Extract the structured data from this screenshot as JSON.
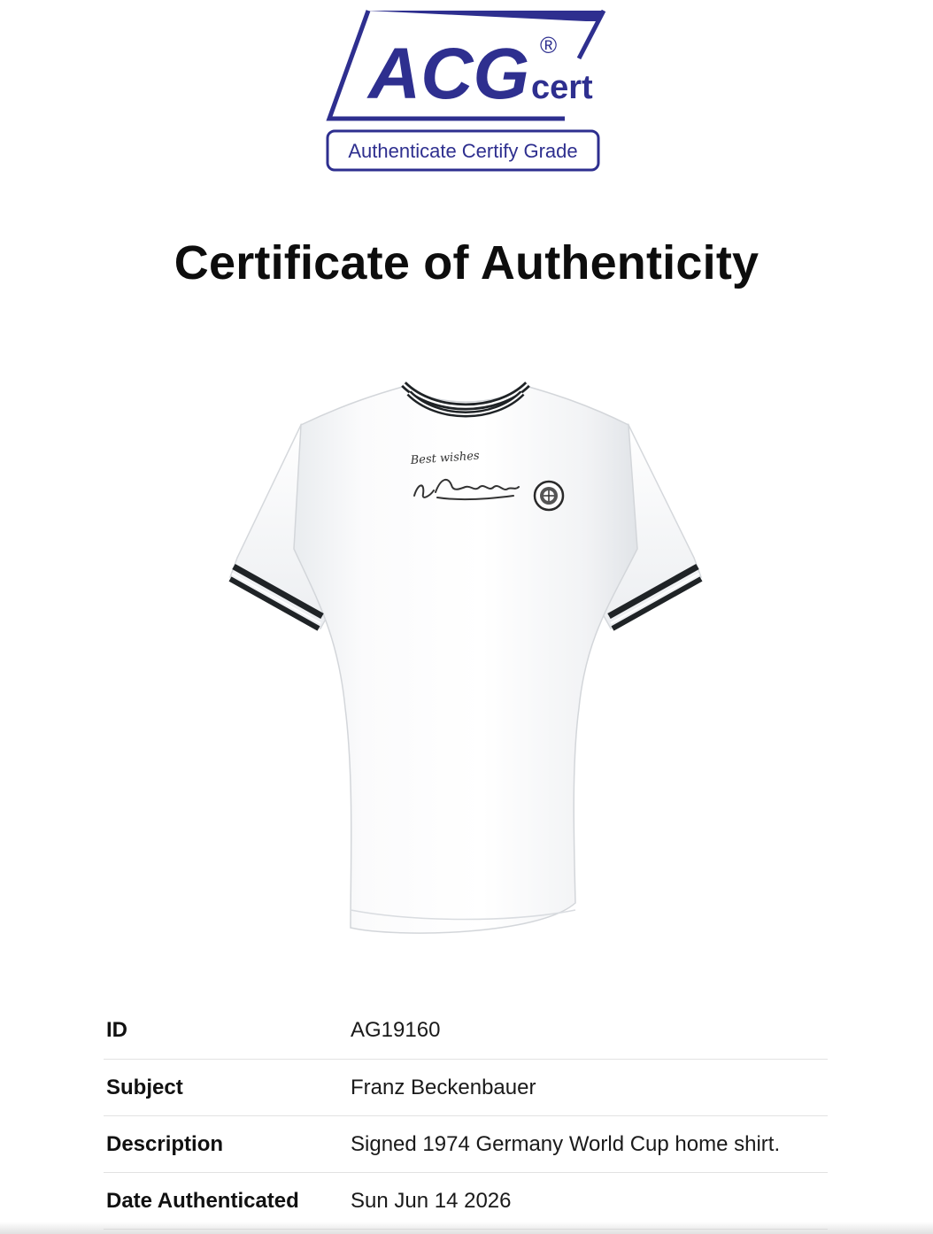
{
  "brand": {
    "logo_text": "ACG",
    "logo_sub": "cert",
    "registered": "®",
    "tagline": "Authenticate Certify Grade",
    "color": "#2e2f8f"
  },
  "page_title": "Certificate of Authenticity",
  "product_image": {
    "icon": "signed-shirt-image",
    "signature_line1": "Best wishes",
    "signature_line2": "F. Beckenbauer"
  },
  "details": {
    "rows": [
      {
        "label": "ID",
        "value": "AG19160"
      },
      {
        "label": "Subject",
        "value": "Franz Beckenbauer"
      },
      {
        "label": "Description",
        "value": "Signed 1974 Germany World Cup home shirt."
      },
      {
        "label": "Date Authenticated",
        "value": "Sun Jun 14 2026"
      }
    ]
  }
}
